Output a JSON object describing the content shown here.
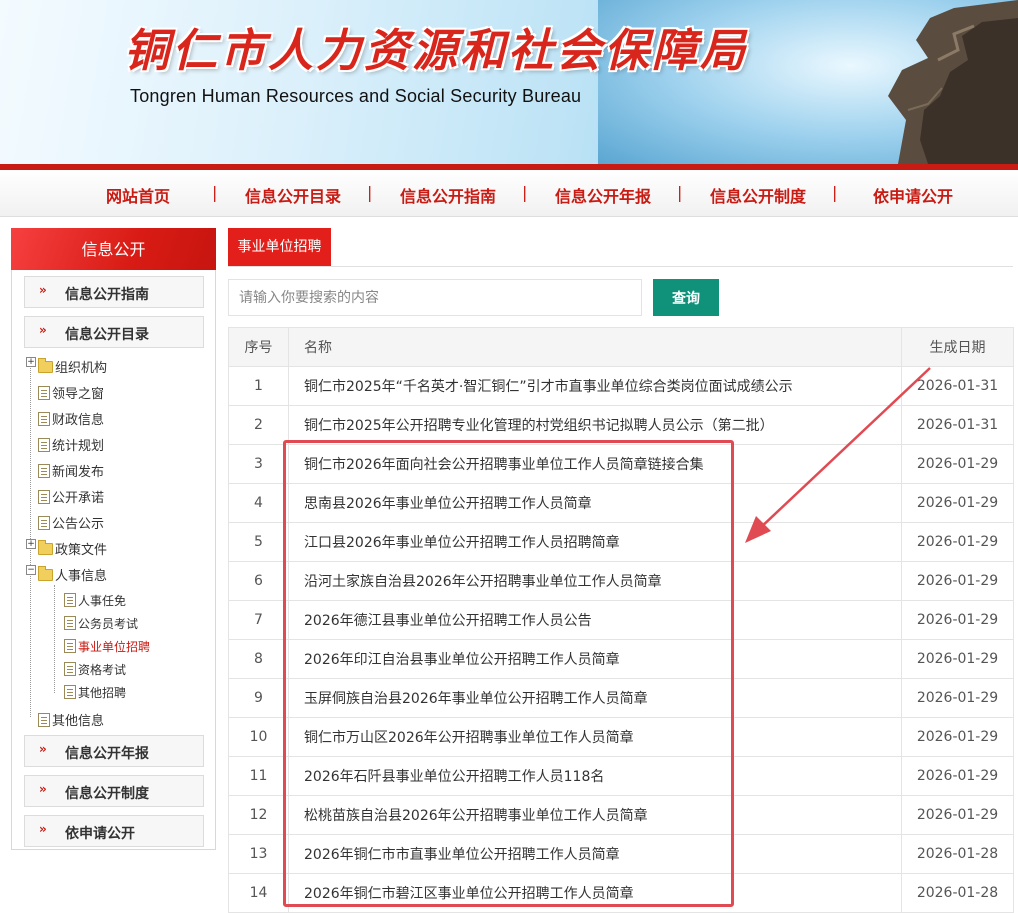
{
  "header": {
    "title": "铜仁市人力资源和社会保障局",
    "subtitle": "Tongren Human Resources and Social Security Bureau"
  },
  "nav": {
    "items": [
      {
        "label": "网站首页"
      },
      {
        "label": "信息公开目录"
      },
      {
        "label": "信息公开指南"
      },
      {
        "label": "信息公开年报"
      },
      {
        "label": "信息公开制度"
      },
      {
        "label": "依申请公开"
      }
    ],
    "separator": "|"
  },
  "sidebar": {
    "header": "信息公开",
    "boxes_top": [
      {
        "label": "信息公开指南"
      },
      {
        "label": "信息公开目录"
      }
    ],
    "tree": [
      {
        "label": "组织机构"
      },
      {
        "label": "领导之窗"
      },
      {
        "label": "财政信息"
      },
      {
        "label": "统计规划"
      },
      {
        "label": "新闻发布"
      },
      {
        "label": "公开承诺"
      },
      {
        "label": "公告公示"
      },
      {
        "label": "政策文件"
      },
      {
        "label": "人事信息"
      },
      {
        "label": "其他信息"
      }
    ],
    "tree_sub": [
      {
        "label": "人事任免"
      },
      {
        "label": "公务员考试"
      },
      {
        "label": "事业单位招聘"
      },
      {
        "label": "资格考试"
      },
      {
        "label": "其他招聘"
      }
    ],
    "boxes_bottom": [
      {
        "label": "信息公开年报"
      },
      {
        "label": "信息公开制度"
      },
      {
        "label": "依申请公开"
      }
    ],
    "chevron": "»"
  },
  "main": {
    "tab": "事业单位招聘",
    "search": {
      "placeholder": "请输入你要搜索的内容",
      "button": "查询"
    },
    "table": {
      "headers": [
        "序号",
        "名称",
        "生成日期"
      ],
      "rows": [
        {
          "idx": "1",
          "name": "铜仁市2025年“千名英才·智汇铜仁”引才市直事业单位综合类岗位面试成绩公示",
          "date": "2026-01-31"
        },
        {
          "idx": "2",
          "name": "铜仁市2025年公开招聘专业化管理的村党组织书记拟聘人员公示（第二批）",
          "date": "2026-01-31"
        },
        {
          "idx": "3",
          "name": "铜仁市2026年面向社会公开招聘事业单位工作人员简章链接合集",
          "date": "2026-01-29"
        },
        {
          "idx": "4",
          "name": "思南县2026年事业单位公开招聘工作人员简章",
          "date": "2026-01-29"
        },
        {
          "idx": "5",
          "name": "江口县2026年事业单位公开招聘工作人员招聘简章",
          "date": "2026-01-29"
        },
        {
          "idx": "6",
          "name": "沿河土家族自治县2026年公开招聘事业单位工作人员简章",
          "date": "2026-01-29"
        },
        {
          "idx": "7",
          "name": "2026年德江县事业单位公开招聘工作人员公告",
          "date": "2026-01-29"
        },
        {
          "idx": "8",
          "name": "2026年印江自治县事业单位公开招聘工作人员简章",
          "date": "2026-01-29"
        },
        {
          "idx": "9",
          "name": "玉屏侗族自治县2026年事业单位公开招聘工作人员简章",
          "date": "2026-01-29"
        },
        {
          "idx": "10",
          "name": "铜仁市万山区2026年公开招聘事业单位工作人员简章",
          "date": "2026-01-29"
        },
        {
          "idx": "11",
          "name": "2026年石阡县事业单位公开招聘工作人员118名",
          "date": "2026-01-29"
        },
        {
          "idx": "12",
          "name": "松桃苗族自治县2026年公开招聘事业单位工作人员简章",
          "date": "2026-01-29"
        },
        {
          "idx": "13",
          "name": "2026年铜仁市市直事业单位公开招聘工作人员简章",
          "date": "2026-01-28"
        },
        {
          "idx": "14",
          "name": "2026年铜仁市碧江区事业单位公开招聘工作人员简章",
          "date": "2026-01-28"
        }
      ]
    }
  },
  "colors": {
    "brand_red": "#c81b13",
    "tab_red": "#e21f1a",
    "search_green": "#0f9279",
    "annotation": "#e04a52"
  }
}
